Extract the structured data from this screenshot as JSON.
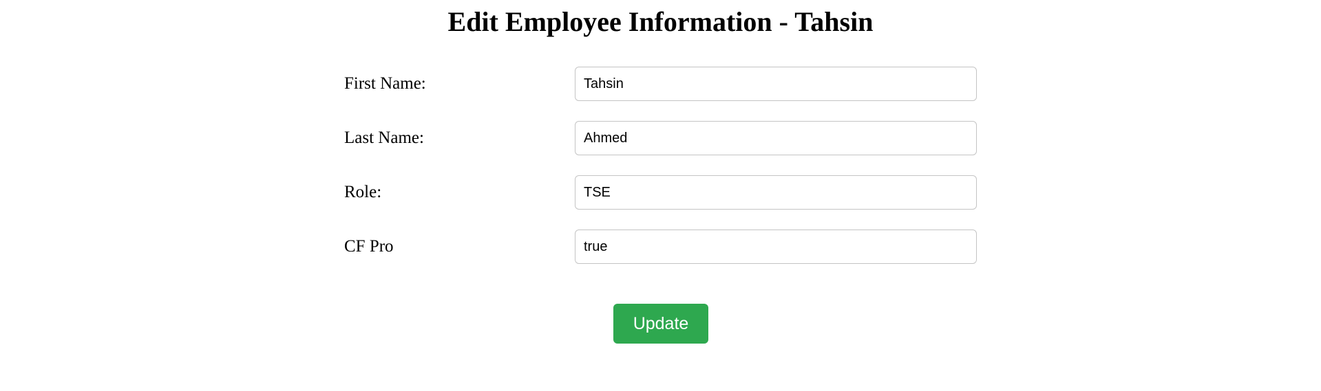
{
  "page": {
    "title": "Edit Employee Information - Tahsin"
  },
  "form": {
    "fields": [
      {
        "label": "First Name:",
        "value": "Tahsin"
      },
      {
        "label": "Last Name:",
        "value": "Ahmed"
      },
      {
        "label": "Role:",
        "value": "TSE"
      },
      {
        "label": "CF Pro",
        "value": "true"
      }
    ],
    "submit_label": "Update"
  },
  "colors": {
    "button_background": "#2ea84f",
    "button_text": "#ffffff",
    "input_border": "#c4c4c4"
  }
}
